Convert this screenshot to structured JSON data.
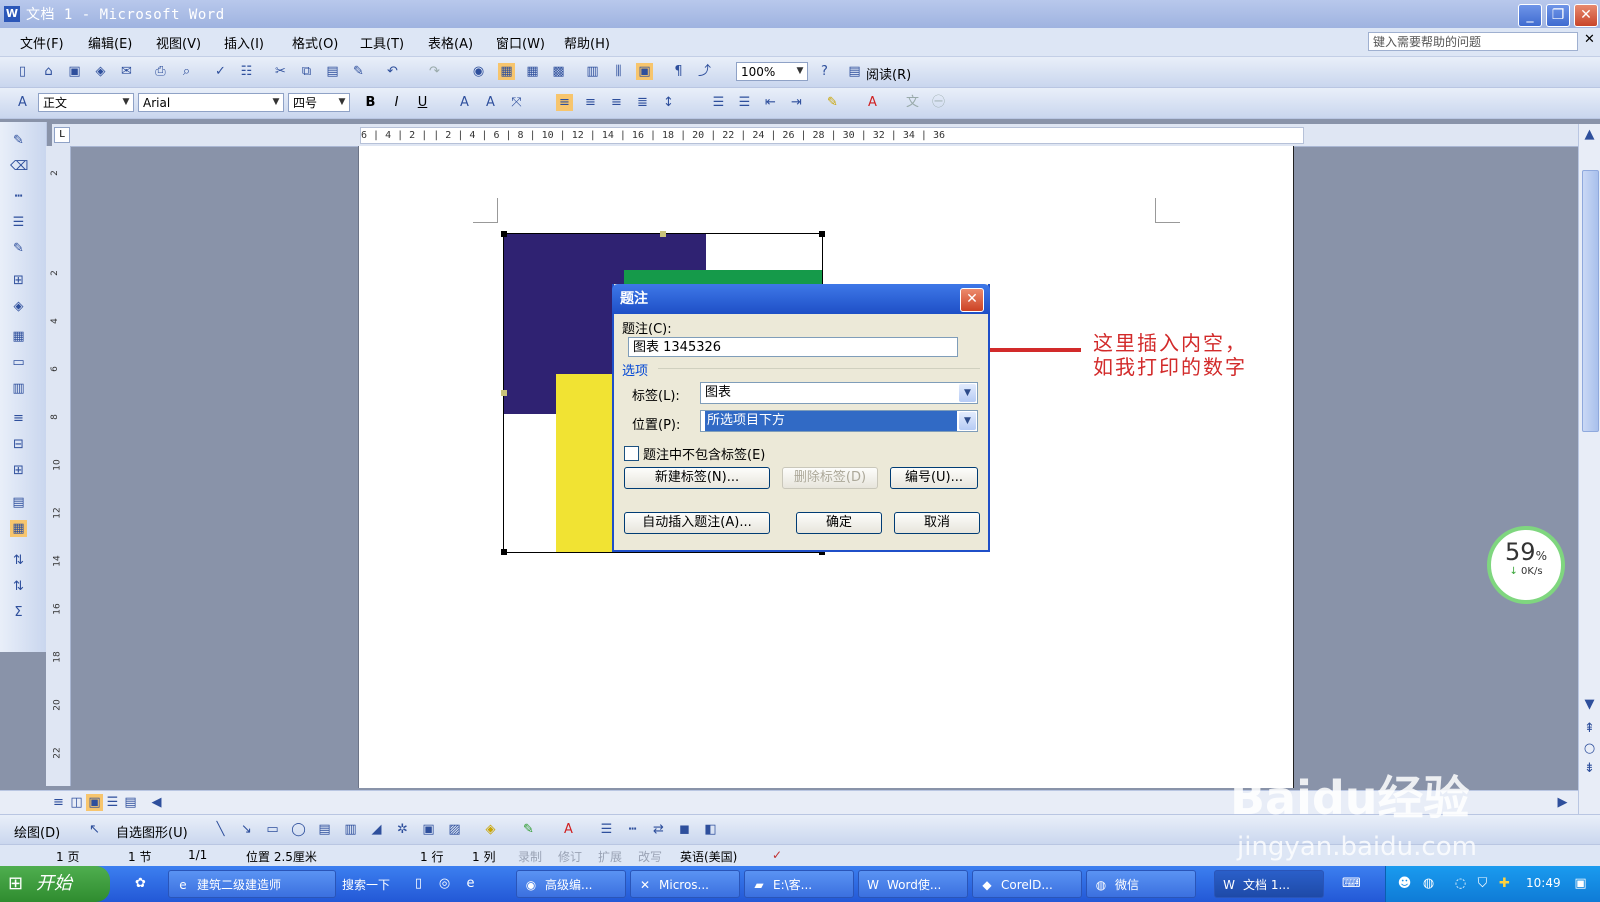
{
  "window": {
    "title": "文档 1 - Microsoft Word"
  },
  "menu": {
    "items": [
      "文件(F)",
      "编辑(E)",
      "视图(V)",
      "插入(I)",
      "格式(O)",
      "工具(T)",
      "表格(A)",
      "窗口(W)",
      "帮助(H)"
    ],
    "help_placeholder": "键入需要帮助的问题"
  },
  "toolbar_standard": {
    "zoom": "100%",
    "read_label": "阅读(R)"
  },
  "toolbar_format": {
    "style": "正文",
    "font": "Arial",
    "size": "四号",
    "bold": "B",
    "italic": "I",
    "underline": "U"
  },
  "ruler": {
    "h_labels": "6 | 4 | 2 |  | 2 | 4 | 6 | 8 | 10 | 12 | 14 | 16 | 18 | 20 | 22 | 24 | 26 | 28 | 30 | 32 | 34 | 36",
    "v_labels": [
      "2",
      "2",
      "4",
      "6",
      "8",
      "10",
      "12",
      "14",
      "16",
      "18",
      "20",
      "22"
    ]
  },
  "dialog": {
    "title": "题注",
    "caption_label": "题注(C):",
    "caption_value": "图表 1345326",
    "options_group": "选项",
    "label_label": "标签(L):",
    "label_value": "图表",
    "position_label": "位置(P):",
    "position_value": "所选项目下方",
    "exclude_label": "题注中不包含标签(E)",
    "new_label_btn": "新建标签(N)...",
    "delete_label_btn": "删除标签(D)",
    "numbering_btn": "编号(U)...",
    "autocaption_btn": "自动插入题注(A)...",
    "ok_btn": "确定",
    "cancel_btn": "取消"
  },
  "annotation": {
    "line1": "这里插入内空，",
    "line2": "如我打印的数字"
  },
  "speed_widget": {
    "percent": "59",
    "percent_sign": "%",
    "rate": "0K/s"
  },
  "draw_toolbar": {
    "draw": "绘图(D)",
    "autoshapes": "自选图形(U)"
  },
  "status": {
    "page": "1 页",
    "section": "1 节",
    "page_of": "1/1",
    "position": "位置 2.5厘米",
    "line": "1 行",
    "col": "1 列",
    "rec": "录制",
    "trk": "修订",
    "ext": "扩展",
    "ovr": "改写",
    "lang": "英语(美国)"
  },
  "taskbar": {
    "start": "开始",
    "search": "搜索一下",
    "tasks": [
      "建筑二级建造师",
      "高级编...",
      "Micros...",
      "E:\\客...",
      "Word使...",
      "CorelD...",
      "微信",
      "文档 1..."
    ],
    "clock": "10:49"
  },
  "watermark": {
    "brand": "Baidu经验",
    "url": "jingyan.baidu.com"
  },
  "colors": {
    "purple": "#2f2272",
    "green": "#159a4a",
    "yellow": "#f1e333",
    "red_arrow": "#d22a2a",
    "dialog_blue": "#1f4fc8"
  }
}
